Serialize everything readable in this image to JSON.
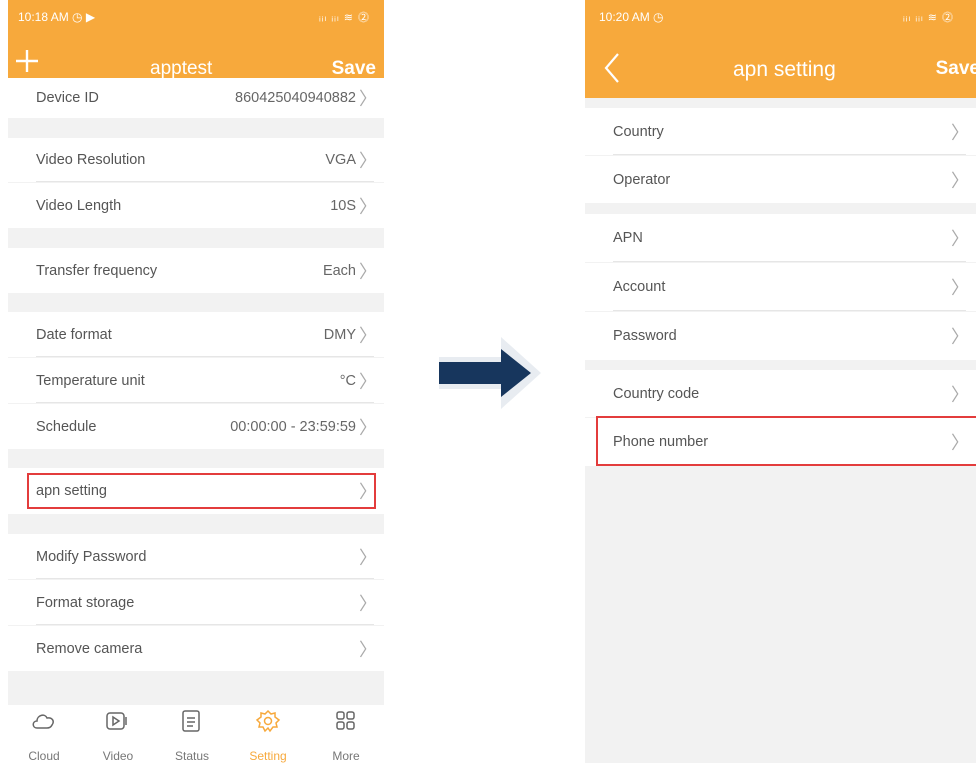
{
  "left": {
    "status_time": "10:18 AM ◷ ▶",
    "status_icons": "ᵢᵢₗ ᵢᵢₗ ≋ ⓶",
    "title": "apptest",
    "save": "Save",
    "add_icon": "plus-icon",
    "partial_row": {
      "label": "Device ID",
      "value": "860425040940882"
    },
    "rows": [
      {
        "label": "Video Resolution",
        "value": "VGA"
      },
      {
        "label": "Video Length",
        "value": "10S"
      },
      {
        "label": "Transfer frequency",
        "value": "Each"
      },
      {
        "label": "Date format",
        "value": "DMY"
      },
      {
        "label": "Temperature unit",
        "value": "°C"
      },
      {
        "label": "Schedule",
        "value": "00:00:00 - 23:59:59"
      },
      {
        "label": "apn setting",
        "value": ""
      },
      {
        "label": "Modify Password",
        "value": ""
      },
      {
        "label": "Format storage",
        "value": ""
      },
      {
        "label": "Remove camera",
        "value": ""
      }
    ],
    "tabs": [
      {
        "label": "Cloud",
        "icon": "cloud-icon"
      },
      {
        "label": "Video",
        "icon": "video-icon"
      },
      {
        "label": "Status",
        "icon": "status-icon"
      },
      {
        "label": "Setting",
        "icon": "gear-icon",
        "active": true
      },
      {
        "label": "More",
        "icon": "more-grid-icon"
      }
    ]
  },
  "right": {
    "status_time": "10:20 AM ◷",
    "status_icons": "ᵢᵢₗ ᵢᵢₗ ≋ ⓶",
    "title": "apn setting",
    "save": "Save",
    "back_icon": "back-chevron-icon",
    "rows": [
      {
        "label": "Country"
      },
      {
        "label": "Operator"
      },
      {
        "label": "APN"
      },
      {
        "label": "Account"
      },
      {
        "label": "Password"
      },
      {
        "label": "Country code"
      },
      {
        "label": "Phone number"
      }
    ]
  },
  "colors": {
    "accent": "#f7a93c",
    "highlight": "#e33c3c",
    "arrow": "#17365d"
  },
  "arrow_icon": "right-arrow-icon"
}
